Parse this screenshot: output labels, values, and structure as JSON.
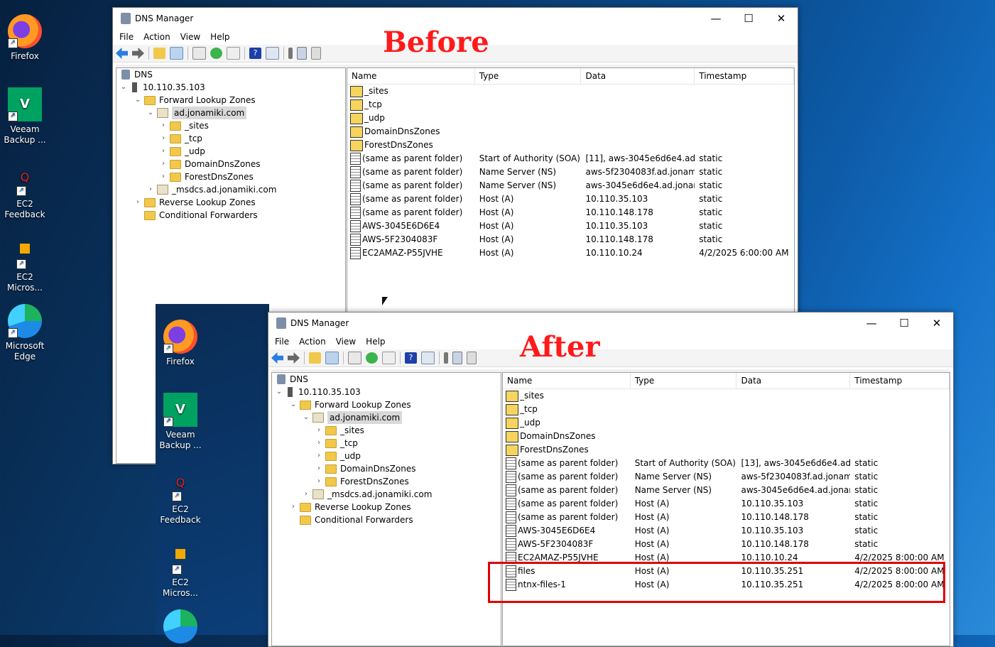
{
  "desktop_left": [
    {
      "label": "Firefox",
      "icon": "firefox-icon"
    },
    {
      "label": "Veeam Backup ...",
      "icon": "veeam-icon"
    },
    {
      "label": "EC2 Feedback",
      "icon": "ec2-feedback-icon"
    },
    {
      "label": "EC2 Micros...",
      "icon": "ec2-micros-icon"
    },
    {
      "label": "Microsoft Edge",
      "icon": "edge-icon"
    }
  ],
  "desktop_inner": [
    {
      "label": "Firefox"
    },
    {
      "label": "Veeam Backup ..."
    },
    {
      "label": "EC2 Feedback"
    },
    {
      "label": "EC2 Micros..."
    }
  ],
  "labels": {
    "before": "Before",
    "after": "After"
  },
  "window": {
    "title": "DNS Manager",
    "menu": [
      "File",
      "Action",
      "View",
      "Help"
    ],
    "controls": {
      "minimize": "—",
      "maximize": "☐",
      "close": "✕"
    }
  },
  "tree": [
    {
      "label": "DNS"
    },
    {
      "label": "10.110.35.103"
    },
    {
      "label": "Forward Lookup Zones"
    },
    {
      "label": "ad.jonamiki.com"
    },
    {
      "label": "_sites"
    },
    {
      "label": "_tcp"
    },
    {
      "label": "_udp"
    },
    {
      "label": "DomainDnsZones"
    },
    {
      "label": "ForestDnsZones"
    },
    {
      "label": "_msdcs.ad.jonamiki.com"
    },
    {
      "label": "Reverse Lookup Zones"
    },
    {
      "label": "Conditional Forwarders"
    }
  ],
  "columns": [
    "Name",
    "Type",
    "Data",
    "Timestamp"
  ],
  "before_rows": [
    [
      "_sites",
      "",
      "",
      ""
    ],
    [
      "_tcp",
      "",
      "",
      ""
    ],
    [
      "_udp",
      "",
      "",
      ""
    ],
    [
      "DomainDnsZones",
      "",
      "",
      ""
    ],
    [
      "ForestDnsZones",
      "",
      "",
      ""
    ],
    [
      "(same as parent folder)",
      "Start of Authority (SOA)",
      "[11], aws-3045e6d6e4.ad.j...",
      "static"
    ],
    [
      "(same as parent folder)",
      "Name Server (NS)",
      "aws-5f2304083f.ad.jonami...",
      "static"
    ],
    [
      "(same as parent folder)",
      "Name Server (NS)",
      "aws-3045e6d6e4.ad.jonam...",
      "static"
    ],
    [
      "(same as parent folder)",
      "Host (A)",
      "10.110.35.103",
      "static"
    ],
    [
      "(same as parent folder)",
      "Host (A)",
      "10.110.148.178",
      "static"
    ],
    [
      "AWS-3045E6D6E4",
      "Host (A)",
      "10.110.35.103",
      "static"
    ],
    [
      "AWS-5F2304083F",
      "Host (A)",
      "10.110.148.178",
      "static"
    ],
    [
      "EC2AMAZ-P55JVHE",
      "Host (A)",
      "10.110.10.24",
      "4/2/2025 6:00:00 AM"
    ]
  ],
  "after_rows": [
    [
      "_sites",
      "",
      "",
      ""
    ],
    [
      "_tcp",
      "",
      "",
      ""
    ],
    [
      "_udp",
      "",
      "",
      ""
    ],
    [
      "DomainDnsZones",
      "",
      "",
      ""
    ],
    [
      "ForestDnsZones",
      "",
      "",
      ""
    ],
    [
      "(same as parent folder)",
      "Start of Authority (SOA)",
      "[13], aws-3045e6d6e4.ad.j...",
      "static"
    ],
    [
      "(same as parent folder)",
      "Name Server (NS)",
      "aws-5f2304083f.ad.jonami...",
      "static"
    ],
    [
      "(same as parent folder)",
      "Name Server (NS)",
      "aws-3045e6d6e4.ad.jonam...",
      "static"
    ],
    [
      "(same as parent folder)",
      "Host (A)",
      "10.110.35.103",
      "static"
    ],
    [
      "(same as parent folder)",
      "Host (A)",
      "10.110.148.178",
      "static"
    ],
    [
      "AWS-3045E6D6E4",
      "Host (A)",
      "10.110.35.103",
      "static"
    ],
    [
      "AWS-5F2304083F",
      "Host (A)",
      "10.110.148.178",
      "static"
    ],
    [
      "EC2AMAZ-P55JVHE",
      "Host (A)",
      "10.110.10.24",
      "4/2/2025 8:00:00 AM"
    ],
    [
      "files",
      "Host (A)",
      "10.110.35.251",
      "4/2/2025 8:00:00 AM"
    ],
    [
      "ntnx-files-1",
      "Host (A)",
      "10.110.35.251",
      "4/2/2025 8:00:00 AM"
    ]
  ],
  "colors": {
    "highlight": "#e00000",
    "label": "#ff1a1a"
  }
}
